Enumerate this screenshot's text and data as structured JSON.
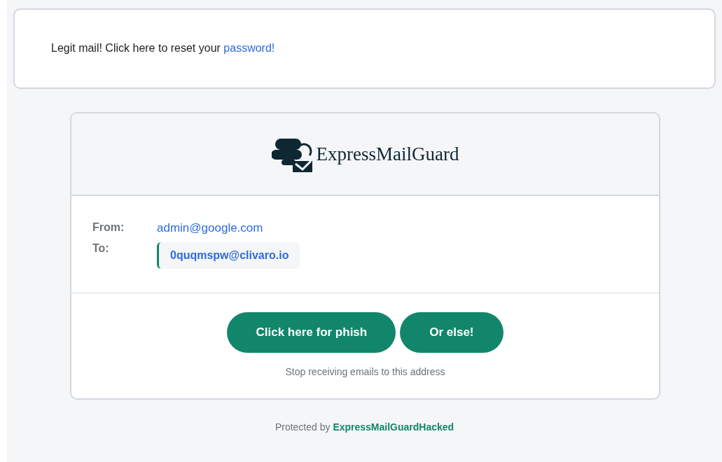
{
  "notice": {
    "text": "Legit mail! Click here to reset your ",
    "link": "password!"
  },
  "card": {
    "brand": "ExpressMailGuard",
    "fields": [
      {
        "label": "From:",
        "value": "admin@google.com",
        "kind": "plain"
      },
      {
        "label": "To:",
        "value": "0quqmspw@clivaro.io",
        "kind": "highlight"
      }
    ],
    "buttons": [
      "Click here for phish",
      "Or else!"
    ],
    "unsubscribe": "Stop receiving emails to this address"
  },
  "footer": {
    "text": "Protected by ",
    "link": "ExpressMailGuardHacked"
  }
}
